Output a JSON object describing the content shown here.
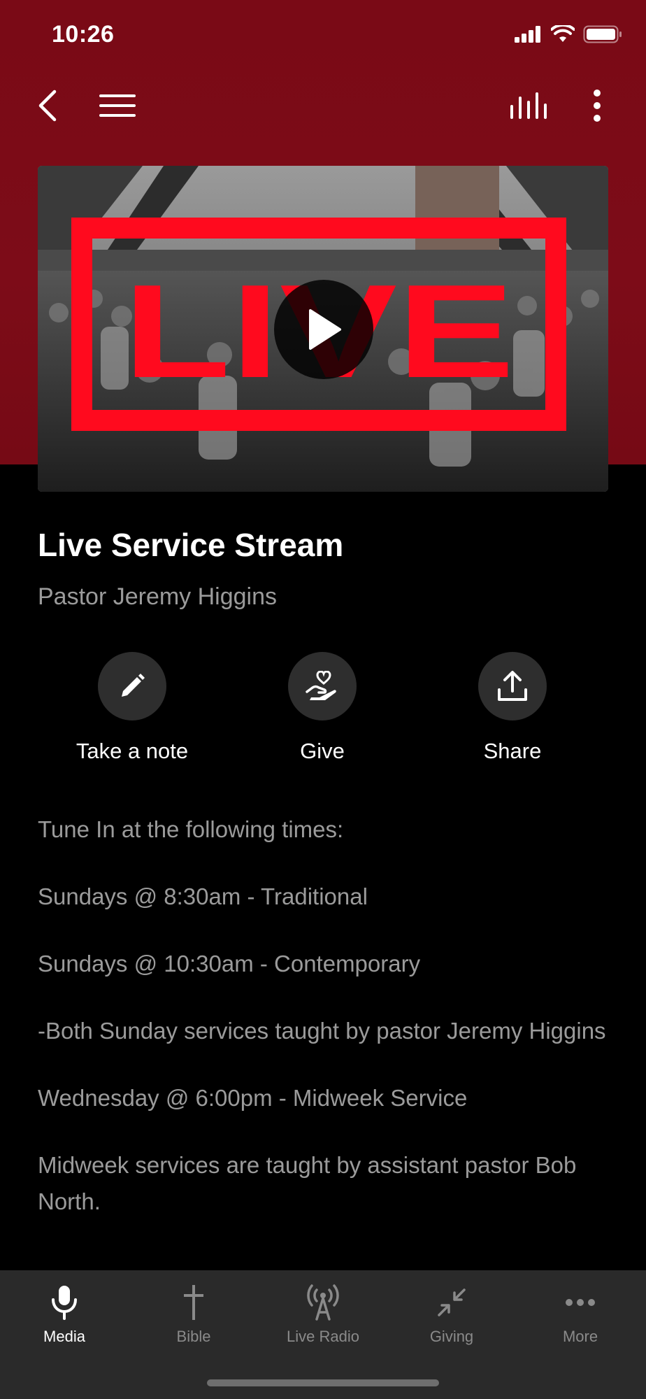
{
  "status": {
    "time": "10:26"
  },
  "colors": {
    "header": "#7a0a16",
    "accent_live": "#ff0a1e",
    "background": "#000000",
    "tabbar": "#2a2a2a"
  },
  "nav": {
    "left_icons": [
      "chevron-left-icon",
      "hamburger-menu-icon"
    ],
    "right_icons": [
      "equalizer-icon",
      "vertical-dots-icon"
    ]
  },
  "video": {
    "overlay_text": "LIVE",
    "play_icon": "play-icon"
  },
  "media": {
    "title": "Live Service Stream",
    "speaker": "Pastor Jeremy Higgins"
  },
  "actions": [
    {
      "label": "Take a note",
      "icon": "pencil-icon"
    },
    {
      "label": "Give",
      "icon": "heart-hand-icon"
    },
    {
      "label": "Share",
      "icon": "share-upload-icon"
    }
  ],
  "description": [
    "Tune In at the following times:",
    "Sundays @ 8:30am - Traditional",
    "Sundays @ 10:30am - Contemporary",
    "-Both Sunday services taught by pastor Jeremy Higgins",
    "Wednesday @ 6:00pm - Midweek Service",
    "Midweek services are taught by assistant pastor Bob North."
  ],
  "tabs": [
    {
      "label": "Media",
      "icon": "microphone-icon",
      "active": true
    },
    {
      "label": "Bible",
      "icon": "cross-icon",
      "active": false
    },
    {
      "label": "Live Radio",
      "icon": "radio-tower-icon",
      "active": false
    },
    {
      "label": "Giving",
      "icon": "arrows-collapse-icon",
      "active": false
    },
    {
      "label": "More",
      "icon": "horizontal-dots-icon",
      "active": false
    }
  ]
}
